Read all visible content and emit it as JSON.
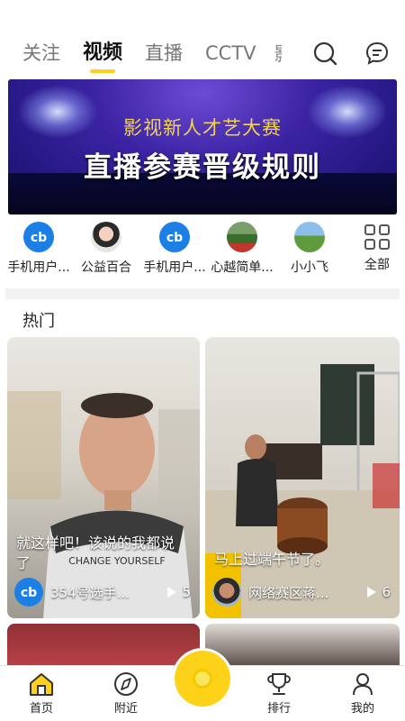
{
  "top_tabs": [
    "关注",
    "视频",
    "直播",
    "CCTV"
  ],
  "active_tab_index": 1,
  "banner": {
    "subtitle": "影视新人才艺大赛",
    "title": "直播参赛晋级规则"
  },
  "quick_entries": [
    {
      "label": "手机用户...",
      "avatar": "app-logo"
    },
    {
      "label": "公益百合",
      "avatar": "woman-photo"
    },
    {
      "label": "手机用户...",
      "avatar": "app-logo"
    },
    {
      "label": "心越简单...",
      "avatar": "landscape-photo"
    },
    {
      "label": "小小飞",
      "avatar": "field-photo"
    },
    {
      "label": "全部",
      "avatar": "grid-icon"
    }
  ],
  "section": {
    "title": "热门"
  },
  "videos": [
    {
      "caption": "就这样吧！该说的我都说了",
      "author": "354号选手...",
      "plays": "5"
    },
    {
      "caption": "马上过端午节了。",
      "author": "网络赛区蒋...",
      "plays": "6"
    }
  ],
  "bottom_nav": [
    {
      "label": "首页",
      "icon": "home-icon",
      "active": true
    },
    {
      "label": "附近",
      "icon": "compass-icon",
      "active": false
    },
    {
      "label": "排行",
      "icon": "trophy-icon",
      "active": false
    },
    {
      "label": "我的",
      "icon": "profile-icon",
      "active": false
    }
  ],
  "colors": {
    "accent": "#ffd21a",
    "brand_blue": "#1b7fe6"
  }
}
